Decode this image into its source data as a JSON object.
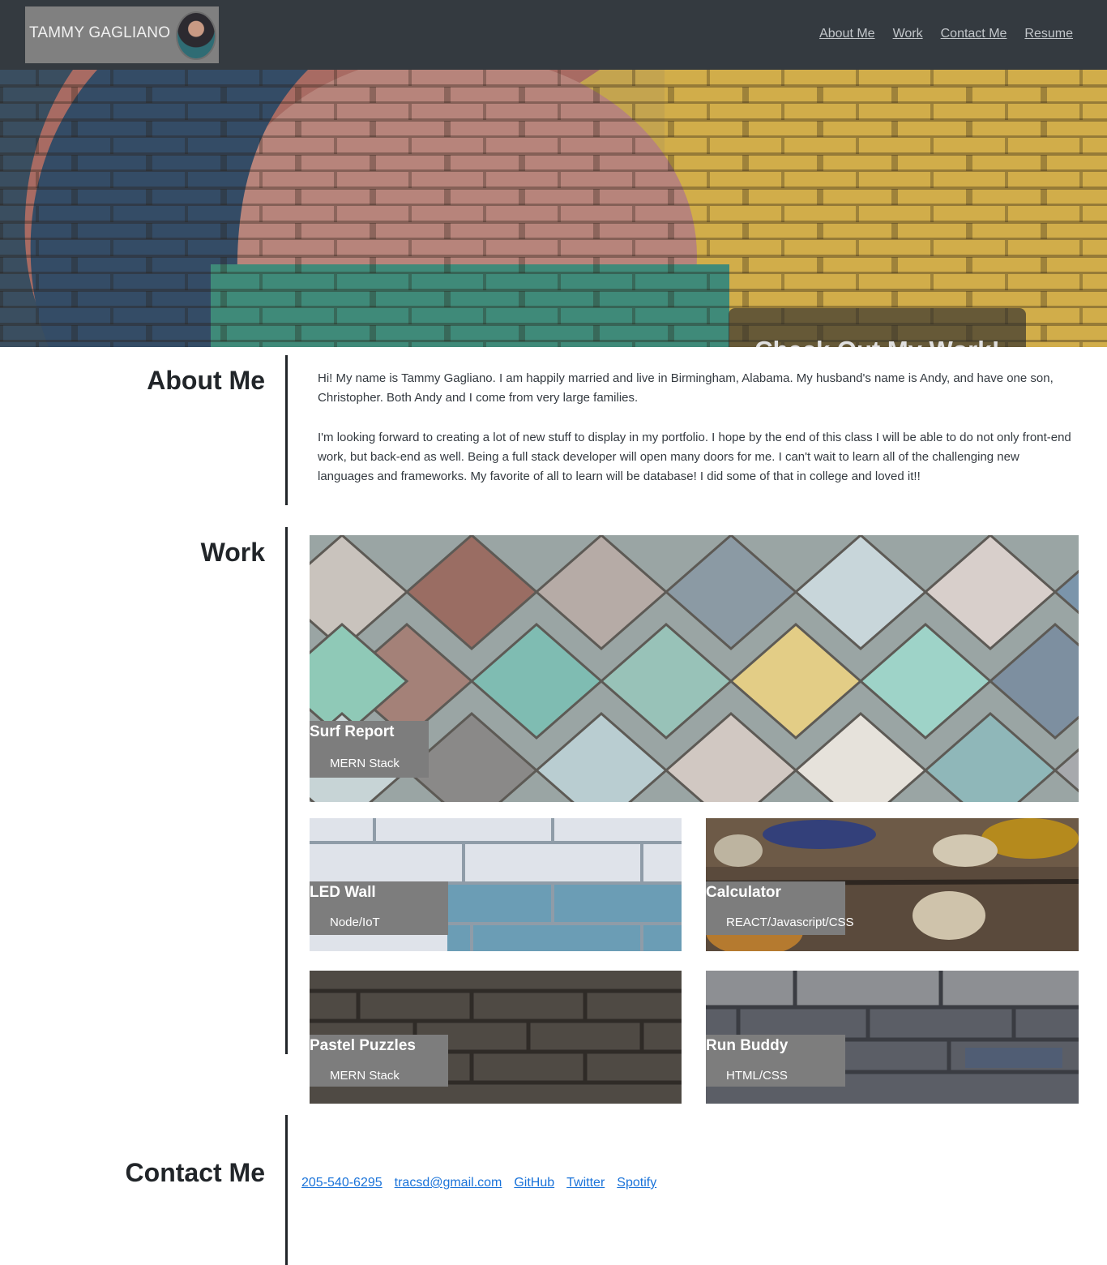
{
  "brand": {
    "name": "TAMMY GAGLIANO"
  },
  "nav": [
    "About Me",
    "Work",
    "Contact Me",
    "Resume"
  ],
  "hero": {
    "cta": "Check Out My Work!"
  },
  "about": {
    "title": "About Me",
    "paragraphs": [
      "Hi! My name is Tammy Gagliano. I am happily married and live in Birmingham, Alabama. My husband's name is Andy, and have one son, Christopher. Both Andy and I come from very large families.",
      "I'm looking forward to creating a lot of new stuff to display in my portfolio. I hope by the end of this class I will be able to do not only front-end work, but back-end as well. Being a full stack developer will open many doors for me. I can't wait to learn all of the challenging new languages and frameworks. My favorite of all to learn will be database! I did some of that in college and loved it!!"
    ]
  },
  "work": {
    "title": "Work",
    "projects": [
      {
        "name": "Surf Report",
        "tech": "MERN Stack"
      },
      {
        "name": "LED Wall",
        "tech": "Node/IoT"
      },
      {
        "name": "Calculator",
        "tech": "REACT/Javascript/CSS"
      },
      {
        "name": "Pastel Puzzles",
        "tech": "MERN Stack"
      },
      {
        "name": "Run Buddy",
        "tech": "HTML/CSS"
      }
    ]
  },
  "contact": {
    "title": "Contact Me",
    "links": [
      "205-540-6295",
      "tracsd@gmail.com",
      "GitHub",
      "Twitter",
      "Spotify"
    ]
  },
  "colors": {
    "header_bg": "#343a40",
    "brand_bg": "#808080",
    "label_bg": "#7d7d7d",
    "link": "#1a73d9"
  }
}
